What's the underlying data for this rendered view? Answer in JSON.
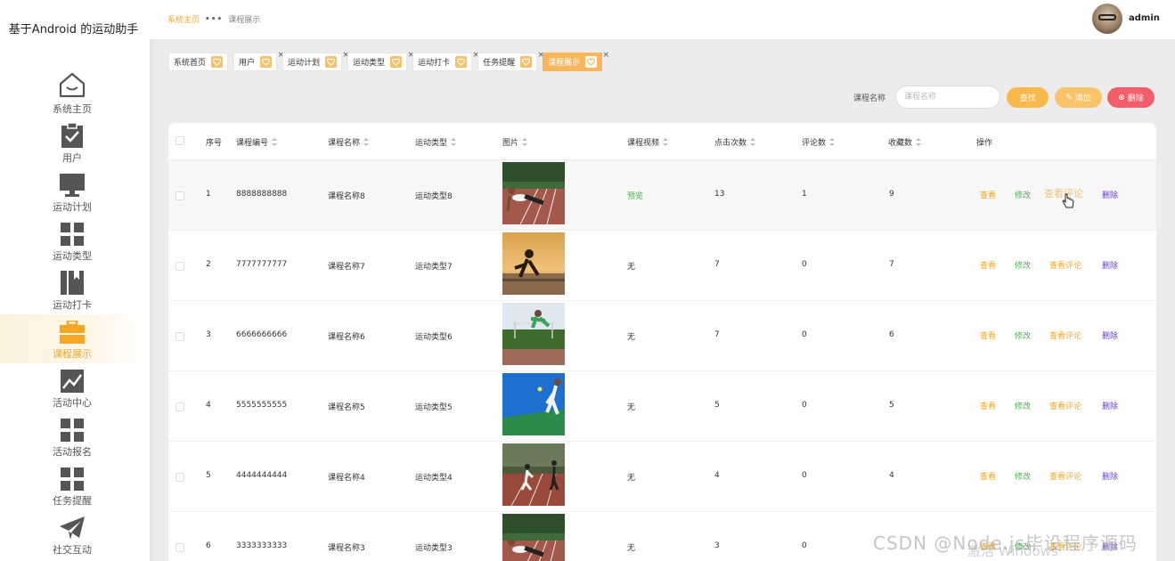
{
  "app": {
    "title": "基于Android 的运动助手"
  },
  "sidebar": {
    "items": [
      {
        "label": "系统主页",
        "icon": "home-icon",
        "active": false
      },
      {
        "label": "用户",
        "icon": "clipboard-check-icon",
        "active": false
      },
      {
        "label": "运动计划",
        "icon": "monitor-icon",
        "active": false
      },
      {
        "label": "运动类型",
        "icon": "grid-icon",
        "active": false
      },
      {
        "label": "运动打卡",
        "icon": "book-icon",
        "active": false
      },
      {
        "label": "课程展示",
        "icon": "briefcase-icon",
        "active": true
      },
      {
        "label": "活动中心",
        "icon": "chart-icon",
        "active": false
      },
      {
        "label": "活动报名",
        "icon": "grid-icon",
        "active": false
      },
      {
        "label": "任务提醒",
        "icon": "grid-icon",
        "active": false
      },
      {
        "label": "社交互动",
        "icon": "paper-plane-icon",
        "active": false
      }
    ]
  },
  "header": {
    "breadcrumb": {
      "home": "系统主页",
      "sep": "•••",
      "current": "课程展示"
    },
    "user": {
      "name": "admin"
    }
  },
  "tags": [
    {
      "label": "系统首页",
      "closable": false,
      "active": false
    },
    {
      "label": "用户",
      "closable": true,
      "active": false
    },
    {
      "label": "运动计划",
      "closable": true,
      "active": false
    },
    {
      "label": "运动类型",
      "closable": true,
      "active": false
    },
    {
      "label": "运动打卡",
      "closable": true,
      "active": false
    },
    {
      "label": "任务提醒",
      "closable": true,
      "active": false
    },
    {
      "label": "课程展示",
      "closable": true,
      "active": true
    }
  ],
  "search": {
    "label": "课程名称",
    "placeholder": "课程名称",
    "search_btn": "查找",
    "add_btn": "添加",
    "delete_btn": "删除"
  },
  "table": {
    "headers": {
      "index": "序号",
      "code": "课程编号",
      "name": "课程名称",
      "type": "运动类型",
      "image": "图片",
      "video": "课程视频",
      "clicks": "点击次数",
      "comments": "评论数",
      "favorites": "收藏数",
      "ops": "操作"
    },
    "actions": {
      "view": "查看",
      "edit": "修改",
      "comment": "查看评论",
      "delete": "删除"
    },
    "rows": [
      {
        "index": "1",
        "code": "8888888888",
        "name": "课程名称8",
        "type": "运动类型8",
        "video": "预览",
        "clicks": "13",
        "comments": "1",
        "favorites": "9"
      },
      {
        "index": "2",
        "code": "7777777777",
        "name": "课程名称7",
        "type": "运动类型7",
        "video": "无",
        "clicks": "7",
        "comments": "0",
        "favorites": "7"
      },
      {
        "index": "3",
        "code": "6666666666",
        "name": "课程名称6",
        "type": "运动类型6",
        "video": "无",
        "clicks": "7",
        "comments": "0",
        "favorites": "6"
      },
      {
        "index": "4",
        "code": "5555555555",
        "name": "课程名称5",
        "type": "运动类型5",
        "video": "无",
        "clicks": "5",
        "comments": "0",
        "favorites": "5"
      },
      {
        "index": "5",
        "code": "4444444444",
        "name": "课程名称4",
        "type": "运动类型4",
        "video": "无",
        "clicks": "4",
        "comments": "0",
        "favorites": "4"
      },
      {
        "index": "6",
        "code": "3333333333",
        "name": "课程名称3",
        "type": "运动类型3",
        "video": "无",
        "clicks": "3",
        "comments": "0",
        "favorites": ""
      }
    ]
  },
  "watermark": {
    "line1": "CSDN @Node.js毕设程序源码",
    "line2": "激活 Windows"
  },
  "colors": {
    "accent": "#f5a623",
    "delete": "#f35e6a",
    "edit": "#4caf50",
    "purple": "#6a3fc7"
  }
}
